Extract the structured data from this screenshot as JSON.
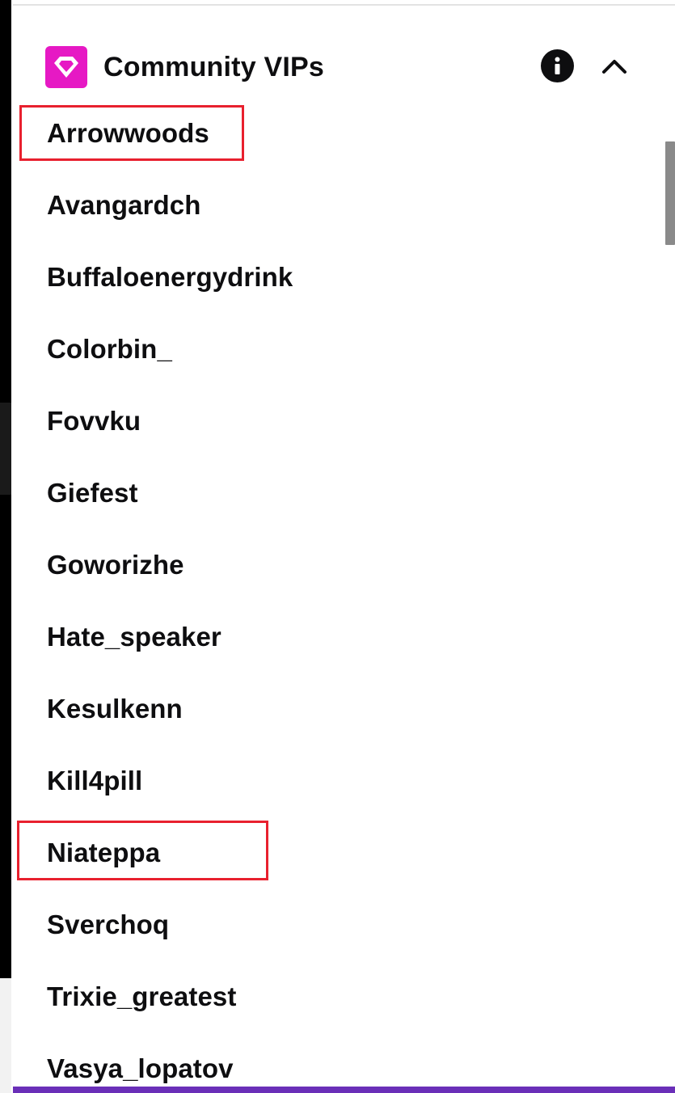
{
  "section": {
    "title": "Community VIPs",
    "badge_icon": "vip-diamond-icon",
    "badge_color": "#e619c4",
    "info_icon": "info-icon",
    "collapse_icon": "chevron-up-icon"
  },
  "vips": [
    {
      "label": "Arrowwoods"
    },
    {
      "label": "Avangardch"
    },
    {
      "label": "Buffaloenergydrink"
    },
    {
      "label": "Colorbin_"
    },
    {
      "label": "Fovvku"
    },
    {
      "label": "Giefest"
    },
    {
      "label": "Goworizhe"
    },
    {
      "label": "Hate_speaker"
    },
    {
      "label": "Kesulkenn"
    },
    {
      "label": "Kill4pill"
    },
    {
      "label": "Niateppa"
    },
    {
      "label": "Sverchoq"
    },
    {
      "label": "Trixie_greatest"
    },
    {
      "label": "Vasya_lopatov"
    }
  ],
  "colors": {
    "text": "#0e0e10",
    "highlight": "#e8202e",
    "accent_bar": "#6a2fb8"
  }
}
